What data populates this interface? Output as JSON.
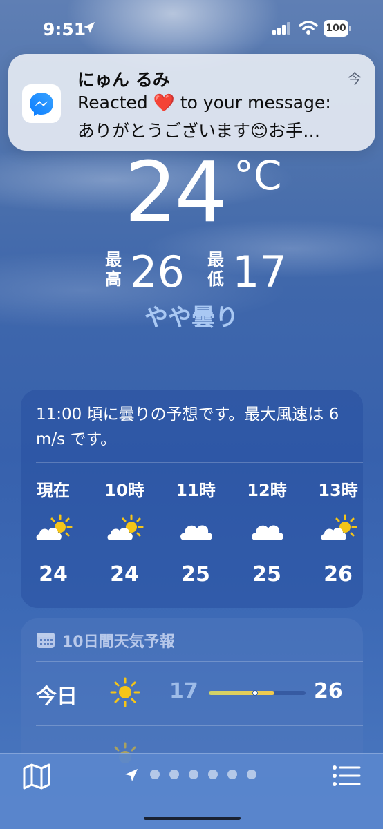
{
  "status_bar": {
    "time": "9:51",
    "battery": "100",
    "location_icon": "location-arrow-icon",
    "signal_icon": "cellular-signal-icon",
    "wifi_icon": "wifi-icon"
  },
  "notification": {
    "app_icon": "messenger-icon",
    "sender": "にゅん るみ",
    "time": "今",
    "line1": "Reacted ❤️ to your message:",
    "line2": "ありがとうございます😊お手…"
  },
  "current": {
    "temperature": "24",
    "unit": "°C",
    "high_label": "最高",
    "high": "26",
    "low_label": "最低",
    "low": "17",
    "condition": "やや曇り"
  },
  "hourly": {
    "summary": "11:00 頃に曇りの予想です。最大風速は 6 m/s です。",
    "items": [
      {
        "label": "現在",
        "icon": "partly-cloudy-icon",
        "temp": "24"
      },
      {
        "label": "10時",
        "icon": "partly-cloudy-icon",
        "temp": "24"
      },
      {
        "label": "11時",
        "icon": "cloud-icon",
        "temp": "25"
      },
      {
        "label": "12時",
        "icon": "cloud-icon",
        "temp": "25"
      },
      {
        "label": "13時",
        "icon": "partly-cloudy-icon",
        "temp": "26"
      }
    ]
  },
  "daily": {
    "title": "10日間天気予報",
    "icon": "calendar-icon",
    "days": [
      {
        "name": "今日",
        "icon": "sun-icon",
        "low": "17",
        "high": "26",
        "range_start": 0.0,
        "range_end": 0.68,
        "current": 0.48
      }
    ]
  },
  "bottom_bar": {
    "map_icon": "map-icon",
    "list_icon": "list-icon",
    "page_count": 6
  },
  "colors": {
    "accent_condition": "#a9c8f3",
    "low_temp": "#9ebce8",
    "sun": "#f5c518"
  }
}
